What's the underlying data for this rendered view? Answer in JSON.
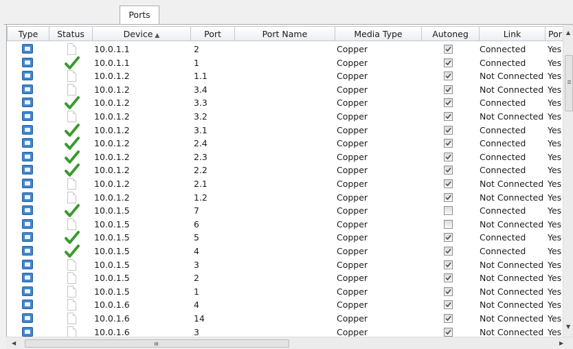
{
  "tabs": [
    {
      "label": "Ports",
      "active": true
    }
  ],
  "table": {
    "sort_indicator": "▲",
    "columns": [
      {
        "key": "type",
        "label": "Type"
      },
      {
        "key": "status",
        "label": "Status"
      },
      {
        "key": "device",
        "label": "Device",
        "sorted": true
      },
      {
        "key": "port",
        "label": "Port"
      },
      {
        "key": "port_name",
        "label": "Port Name"
      },
      {
        "key": "media_type",
        "label": "Media Type"
      },
      {
        "key": "autoneg",
        "label": "Autoneg"
      },
      {
        "key": "link",
        "label": "Link"
      },
      {
        "key": "por",
        "label": "Por"
      }
    ],
    "rows": [
      {
        "status": "document",
        "device": "10.0.1.1",
        "port": "2",
        "port_name": "",
        "media_type": "Copper",
        "autoneg": true,
        "link": "Connected",
        "por": "Yes"
      },
      {
        "status": "check",
        "device": "10.0.1.1",
        "port": "1",
        "port_name": "",
        "media_type": "Copper",
        "autoneg": true,
        "link": "Connected",
        "por": "Yes"
      },
      {
        "status": "document",
        "device": "10.0.1.2",
        "port": "1.1",
        "port_name": "",
        "media_type": "Copper",
        "autoneg": true,
        "link": "Not Connected",
        "por": "Yes"
      },
      {
        "status": "document",
        "device": "10.0.1.2",
        "port": "3.4",
        "port_name": "",
        "media_type": "Copper",
        "autoneg": true,
        "link": "Not Connected",
        "por": "Yes"
      },
      {
        "status": "check",
        "device": "10.0.1.2",
        "port": "3.3",
        "port_name": "",
        "media_type": "Copper",
        "autoneg": true,
        "link": "Connected",
        "por": "Yes"
      },
      {
        "status": "document",
        "device": "10.0.1.2",
        "port": "3.2",
        "port_name": "",
        "media_type": "Copper",
        "autoneg": true,
        "link": "Not Connected",
        "por": "Yes"
      },
      {
        "status": "check",
        "device": "10.0.1.2",
        "port": "3.1",
        "port_name": "",
        "media_type": "Copper",
        "autoneg": true,
        "link": "Connected",
        "por": "Yes"
      },
      {
        "status": "check",
        "device": "10.0.1.2",
        "port": "2.4",
        "port_name": "",
        "media_type": "Copper",
        "autoneg": true,
        "link": "Connected",
        "por": "Yes"
      },
      {
        "status": "check",
        "device": "10.0.1.2",
        "port": "2.3",
        "port_name": "",
        "media_type": "Copper",
        "autoneg": true,
        "link": "Connected",
        "por": "Yes"
      },
      {
        "status": "check",
        "device": "10.0.1.2",
        "port": "2.2",
        "port_name": "",
        "media_type": "Copper",
        "autoneg": true,
        "link": "Connected",
        "por": "Yes"
      },
      {
        "status": "document",
        "device": "10.0.1.2",
        "port": "2.1",
        "port_name": "",
        "media_type": "Copper",
        "autoneg": true,
        "link": "Not Connected",
        "por": "Yes"
      },
      {
        "status": "document",
        "device": "10.0.1.2",
        "port": "1.2",
        "port_name": "",
        "media_type": "Copper",
        "autoneg": true,
        "link": "Not Connected",
        "por": "Yes"
      },
      {
        "status": "check",
        "device": "10.0.1.5",
        "port": "7",
        "port_name": "",
        "media_type": "Copper",
        "autoneg": false,
        "link": "Connected",
        "por": "Yes"
      },
      {
        "status": "document",
        "device": "10.0.1.5",
        "port": "6",
        "port_name": "",
        "media_type": "Copper",
        "autoneg": false,
        "link": "Not Connected",
        "por": "Yes"
      },
      {
        "status": "check",
        "device": "10.0.1.5",
        "port": "5",
        "port_name": "",
        "media_type": "Copper",
        "autoneg": true,
        "link": "Connected",
        "por": "Yes"
      },
      {
        "status": "check",
        "device": "10.0.1.5",
        "port": "4",
        "port_name": "",
        "media_type": "Copper",
        "autoneg": true,
        "link": "Connected",
        "por": "Yes"
      },
      {
        "status": "document",
        "device": "10.0.1.5",
        "port": "3",
        "port_name": "",
        "media_type": "Copper",
        "autoneg": true,
        "link": "Not Connected",
        "por": "Yes"
      },
      {
        "status": "document",
        "device": "10.0.1.5",
        "port": "2",
        "port_name": "",
        "media_type": "Copper",
        "autoneg": true,
        "link": "Not Connected",
        "por": "Yes"
      },
      {
        "status": "document",
        "device": "10.0.1.5",
        "port": "1",
        "port_name": "",
        "media_type": "Copper",
        "autoneg": true,
        "link": "Not Connected",
        "por": "Yes"
      },
      {
        "status": "document",
        "device": "10.0.1.6",
        "port": "4",
        "port_name": "",
        "media_type": "Copper",
        "autoneg": true,
        "link": "Not Connected",
        "por": "Yes"
      },
      {
        "status": "document",
        "device": "10.0.1.6",
        "port": "14",
        "port_name": "",
        "media_type": "Copper",
        "autoneg": true,
        "link": "Not Connected",
        "por": "Yes"
      },
      {
        "status": "document",
        "device": "10.0.1.6",
        "port": "3",
        "port_name": "",
        "media_type": "Copper",
        "autoneg": true,
        "link": "Not Connected",
        "por": "Yes"
      }
    ]
  },
  "scrollbars": {
    "left_arrow": "◀",
    "right_arrow": "▶",
    "up_arrow": "▲",
    "down_arrow": "▼",
    "h_grip": "III"
  },
  "icons": {
    "type_icon": "port-icon",
    "status_icons": [
      "document-icon",
      "check-icon"
    ]
  },
  "colors": {
    "check_green": "#3a9a2f",
    "port_icon_blue": "#3f86d1",
    "header_border": "#c3c6cc"
  }
}
